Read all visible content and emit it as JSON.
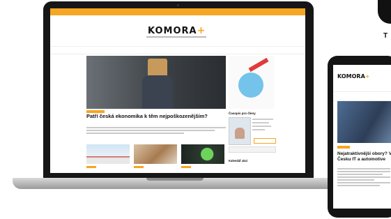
{
  "site": {
    "logo": "KOMORA",
    "logo_plus": "+",
    "nav_items": [
      "",
      "",
      "",
      "",
      "",
      "",
      ""
    ],
    "accent": "#f5a623"
  },
  "article": {
    "title": "Patří česká ekonomika k těm nejpoškozenějším?"
  },
  "sidebar": {
    "magazine_heading": "Časopis pro členy",
    "calendar_label": "Kalendář akcí"
  },
  "phone": {
    "logo": "KOMORA",
    "logo_plus": "+",
    "article_title": "Nejatraktivnější obory? V Česku IT a automotive"
  },
  "corner_letter": "T"
}
